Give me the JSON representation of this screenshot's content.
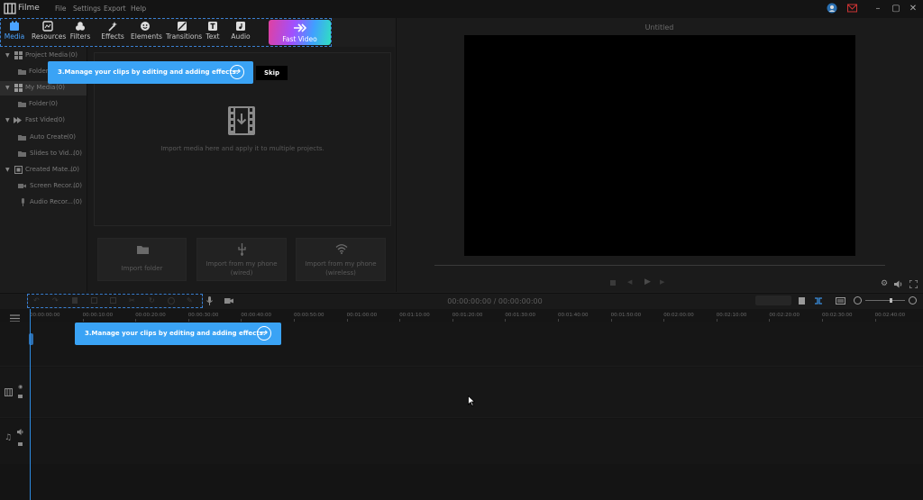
{
  "app": {
    "name": "Filme"
  },
  "menu": [
    "File",
    "Settings",
    "Export",
    "Help"
  ],
  "toolbar": {
    "items": [
      {
        "label": "Media",
        "icon": "media-icon"
      },
      {
        "label": "Resources",
        "icon": "resources-icon"
      },
      {
        "label": "Filters",
        "icon": "filters-icon"
      },
      {
        "label": "Effects",
        "icon": "effects-icon"
      },
      {
        "label": "Elements",
        "icon": "elements-icon"
      },
      {
        "label": "Transitions",
        "icon": "transitions-icon"
      },
      {
        "label": "Text",
        "icon": "text-icon"
      },
      {
        "label": "Audio",
        "icon": "audio-icon"
      }
    ],
    "fast_video": "Fast Video",
    "active": "Media"
  },
  "sidebar": {
    "items": [
      {
        "label": "Project Media",
        "count": "(0)"
      },
      {
        "label": "Folder",
        "count": ""
      },
      {
        "label": "My Media",
        "count": "(0)"
      },
      {
        "label": "Folder",
        "count": "(0)"
      },
      {
        "label": "Fast Video",
        "count": "(0)"
      },
      {
        "label": "Auto Create",
        "count": "(0)"
      },
      {
        "label": "Slides to Vid...",
        "count": "(0)"
      },
      {
        "label": "Created Mate...",
        "count": "(0)"
      },
      {
        "label": "Screen Recor...",
        "count": "(0)"
      },
      {
        "label": "Audio Recor...",
        "count": "(0)"
      }
    ]
  },
  "media": {
    "import_hint": "Import media here and apply it to multiple projects.",
    "tiles": [
      {
        "label": "Import folder"
      },
      {
        "label": "Import from my phone\n(wired)"
      },
      {
        "label": "Import from my phone\n(wireless)"
      }
    ]
  },
  "preview": {
    "title": "Untitled"
  },
  "timeline": {
    "timecode": "00:00:00:00 / 00:00:00:00",
    "ticks": [
      "00:00:00:00",
      "00:00:10:00",
      "00:00:20:00",
      "00:00:30:00",
      "00:00:40:00",
      "00:00:50:00",
      "00:01:00:00",
      "00:01:10:00",
      "00:01:20:00",
      "00:01:30:00",
      "00:01:40:00",
      "00:01:50:00",
      "00:02:00:00",
      "00:02:10:00",
      "00:02:20:00",
      "00:02:30:00",
      "00:02:40:00"
    ]
  },
  "tour": {
    "step_text": "3.Manage your clips by editing and adding effects.",
    "skip_label": "Skip"
  },
  "colors": {
    "accent": "#3aa3f5",
    "playhead": "#2d8ae0"
  }
}
